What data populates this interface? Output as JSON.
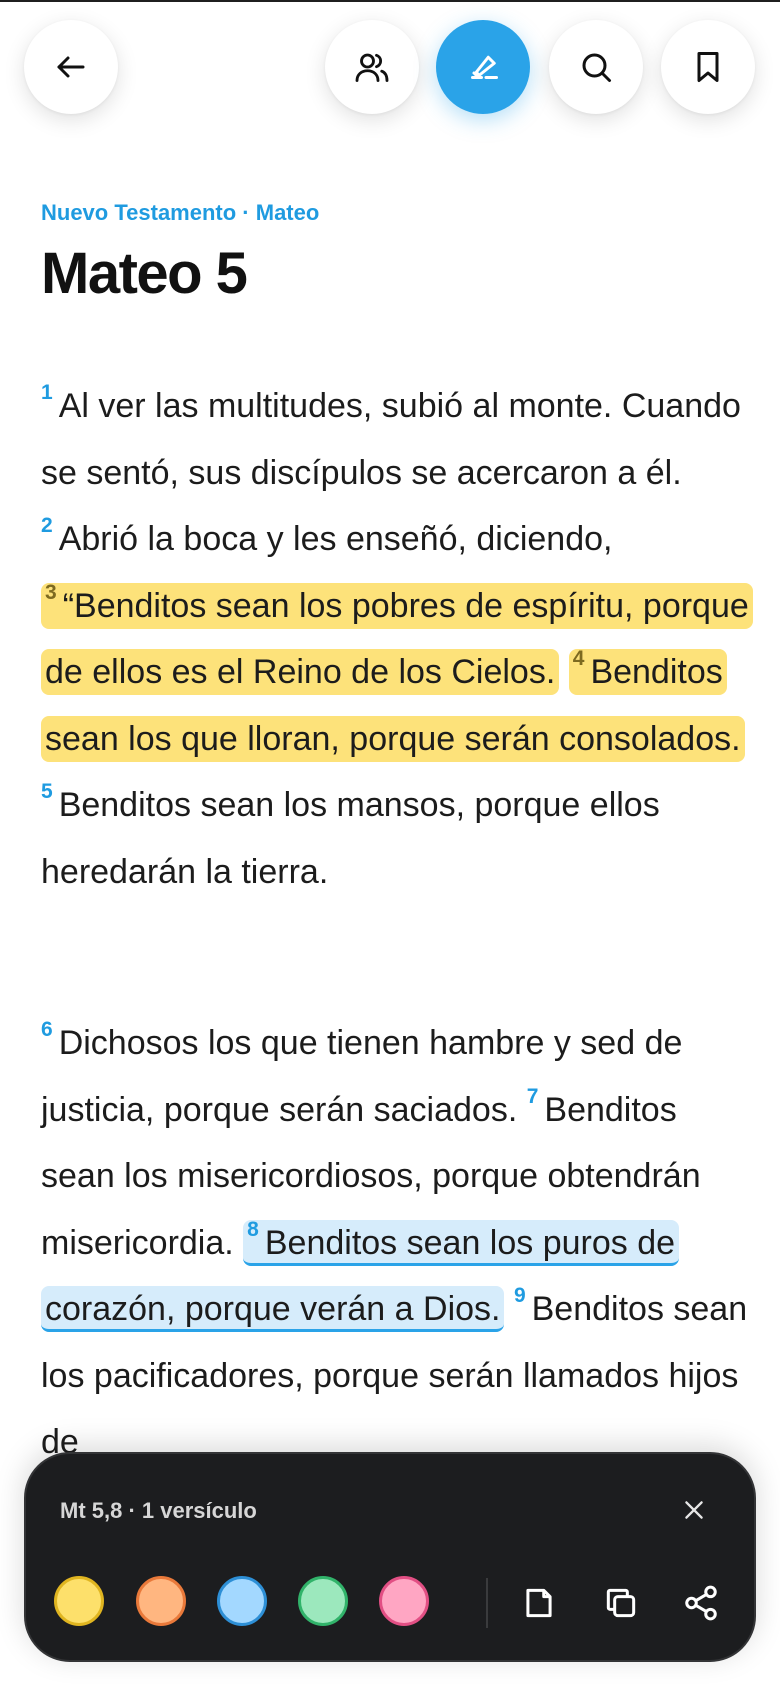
{
  "header": {
    "buttons": [
      {
        "name": "back-button",
        "icon": "arrow-left-icon"
      },
      {
        "name": "people-button",
        "icon": "people-icon"
      },
      {
        "name": "highlight-button",
        "icon": "highlighter-icon",
        "active": true
      },
      {
        "name": "search-button",
        "icon": "search-icon"
      },
      {
        "name": "bookmark-button",
        "icon": "bookmark-icon"
      }
    ]
  },
  "breadcrumb": "Nuevo Testamento · Mateo",
  "chapter_title": "Mateo 5",
  "verses": {
    "v1": {
      "num": "1",
      "text": "Al ver las multitudes, subió al monte. Cuando se sentó, sus discípulos se acercaron a él."
    },
    "v2": {
      "num": "2",
      "text": "Abrió la boca y les enseñó, diciendo,"
    },
    "v3": {
      "num": "3",
      "text": "“Benditos sean los pobres de espíritu, porque de ellos es el Reino de los Cielos."
    },
    "v4": {
      "num": "4",
      "text": "Benditos sean los que lloran, porque serán consolados."
    },
    "v5": {
      "num": "5",
      "text": "Benditos sean los mansos, porque ellos heredarán la tierra."
    },
    "v6": {
      "num": "6",
      "text": "Dichosos los que tienen hambre y sed de justicia, porque serán saciados."
    },
    "v7": {
      "num": "7",
      "text": "Benditos sean los misericordiosos, porque obtendrán misericordia."
    },
    "v8": {
      "num": "8",
      "text": "Benditos sean los puros de corazón, porque verán a Dios."
    },
    "v9": {
      "num": "9",
      "text": "Benditos sean los pacificadores, porque serán llamados hijos de"
    }
  },
  "highlights": {
    "yellow": "#fde27a",
    "selected_blue": "#d6ecfb",
    "accent": "#2aa3e8"
  },
  "sheet": {
    "title": "Mt 5,8 · 1 versículo",
    "colors": [
      {
        "name": "yellow",
        "fill": "#fde06b",
        "border": "#e0b520"
      },
      {
        "name": "orange",
        "fill": "#ffb680",
        "border": "#e9793a"
      },
      {
        "name": "blue",
        "fill": "#a3d8ff",
        "border": "#2d8fd6"
      },
      {
        "name": "green",
        "fill": "#9ce8bd",
        "border": "#31b36a"
      },
      {
        "name": "pink",
        "fill": "#ffa6c3",
        "border": "#e24f84"
      }
    ],
    "actions": [
      "note-icon",
      "copy-icon",
      "share-icon"
    ]
  }
}
